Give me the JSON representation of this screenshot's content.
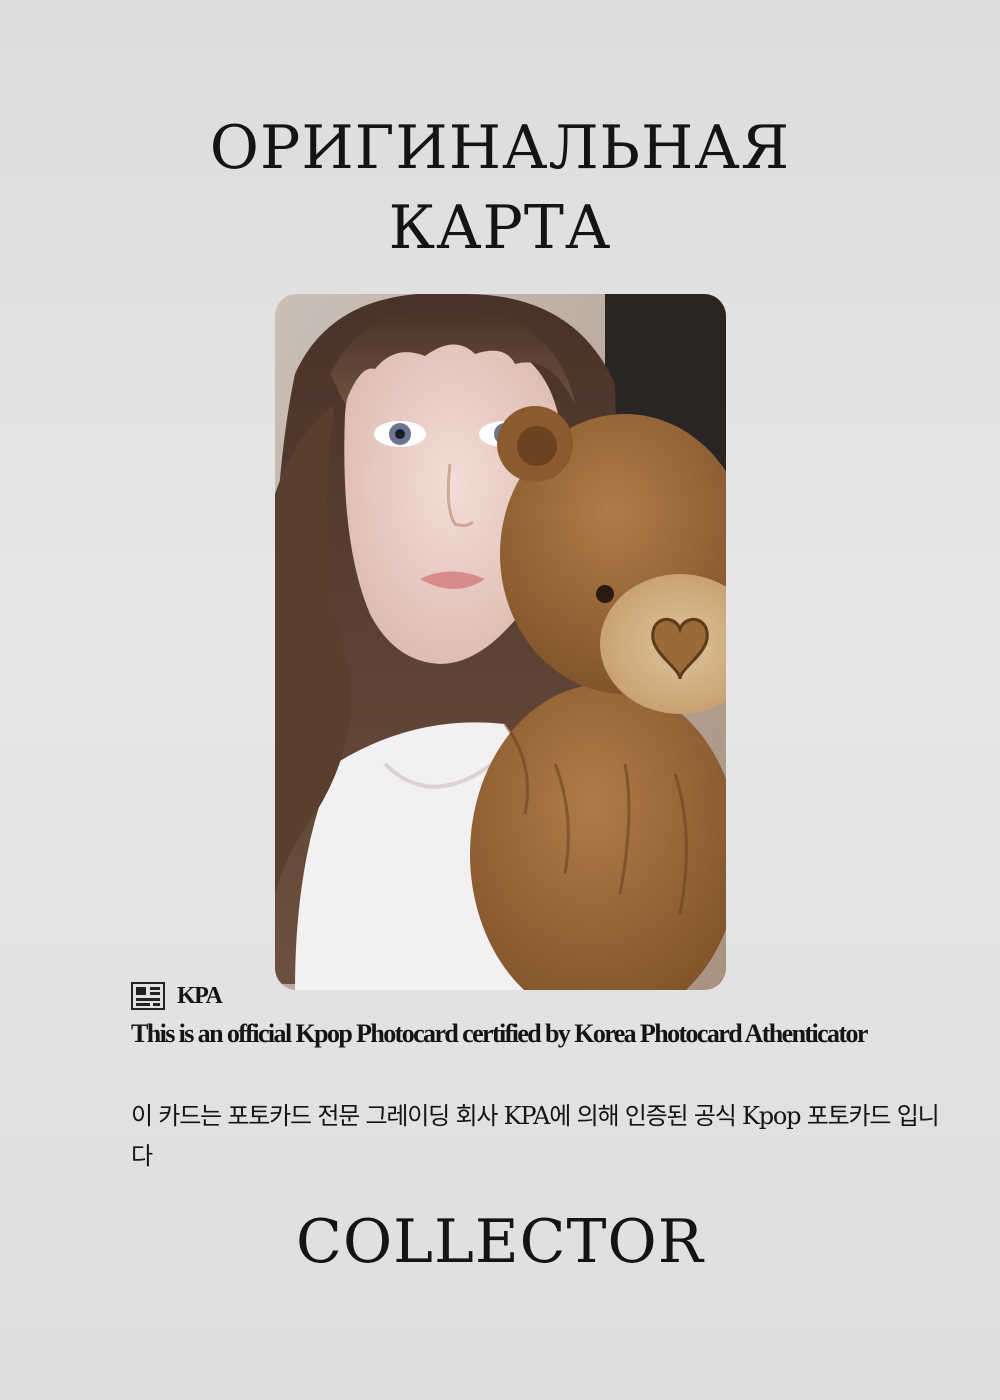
{
  "header": {
    "title_line1": "ОРИГИНАЛЬНАЯ",
    "title_line2": "КАРТА"
  },
  "photocard": {
    "image_alt": "Photocard: woman with long brown hair holding a brown teddy bear with heart nose"
  },
  "certification": {
    "company": "KPA",
    "statement_en": "This is an official Kpop Photocard certified by Korea Photocard Athenticator",
    "statement_ko": "이 카드는 포토카드 전문 그레이딩 회사 KPA에 의해 인증된 공식 Kpop 포토카드 입니다"
  },
  "footer": {
    "label": "COLLECTOR"
  },
  "colors": {
    "background": "#e2e2e3",
    "text": "#141414",
    "bear": "#9b6a3e"
  }
}
